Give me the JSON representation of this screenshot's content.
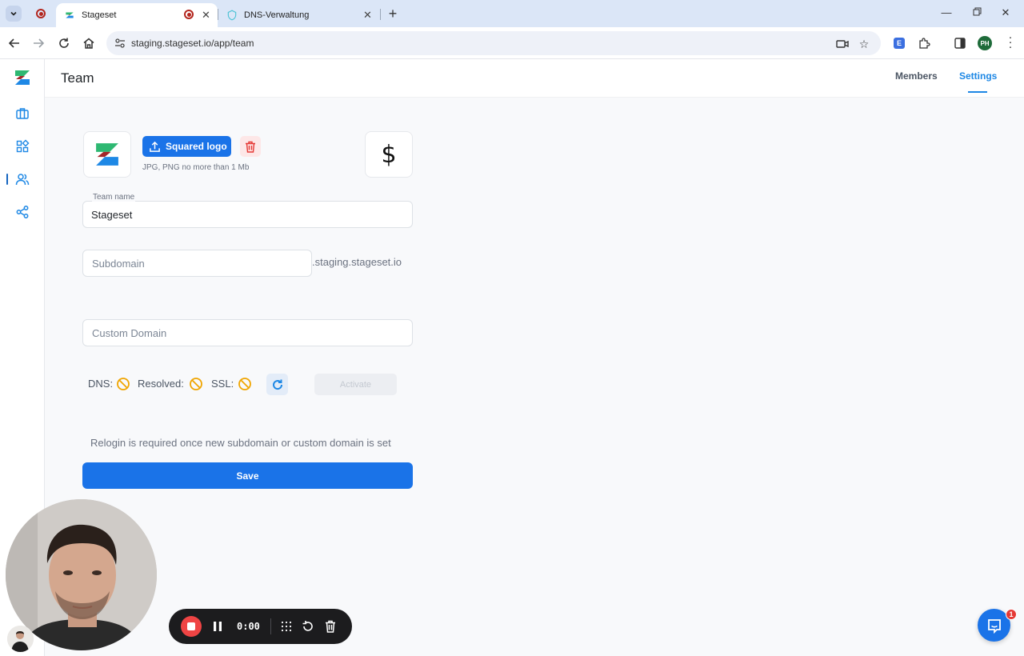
{
  "browser": {
    "tabs": [
      {
        "title": "Stageset",
        "active": true
      },
      {
        "title": "DNS-Verwaltung",
        "active": false
      }
    ],
    "url": "staging.stageset.io/app/team",
    "profile_initials": "PH",
    "extension_label": "E"
  },
  "app": {
    "page_title": "Team",
    "header_tabs": [
      {
        "label": "Members",
        "active": false
      },
      {
        "label": "Settings",
        "active": true
      }
    ],
    "accent_color": "#1a73e8"
  },
  "sidebar": {
    "items": [
      {
        "icon": "briefcase-icon",
        "active": false
      },
      {
        "icon": "grid-icon",
        "active": false
      },
      {
        "icon": "users-icon",
        "active": true
      },
      {
        "icon": "share-icon",
        "active": false
      }
    ]
  },
  "settings": {
    "upload_button": "Squared logo",
    "upload_hint": "JPG, PNG no more than 1 Mb",
    "favicon_preview": "$",
    "team_name_label": "Team name",
    "team_name_value": "Stageset",
    "subdomain_placeholder": "Subdomain",
    "subdomain_suffix": ".staging.stageset.io",
    "custom_domain_placeholder": "Custom Domain",
    "dns_label": "DNS:",
    "resolved_label": "Resolved:",
    "ssl_label": "SSL:",
    "status_color": "#f0a500",
    "activate_button": "Activate",
    "relogin_note": "Relogin is required once new subdomain or custom domain is set",
    "save_button": "Save"
  },
  "recorder": {
    "time": "0:00",
    "stop_color": "#ef4444"
  },
  "chat": {
    "badge_count": "1"
  }
}
